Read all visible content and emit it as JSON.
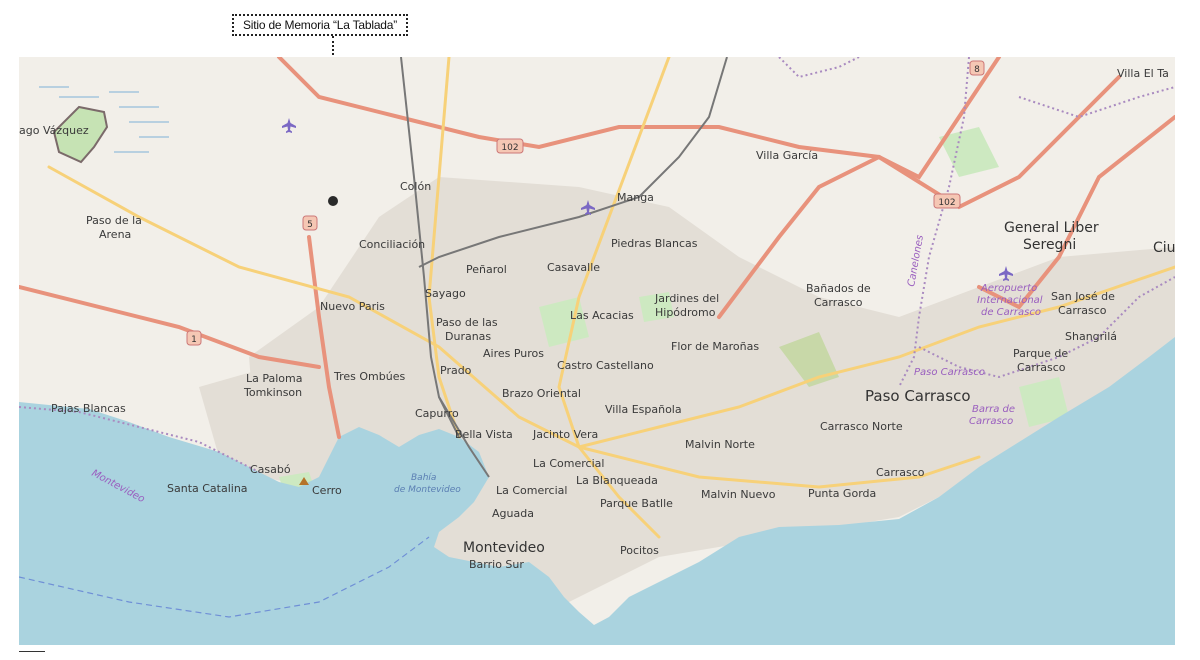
{
  "callout": {
    "text": "Sitio de Memoria “La Tablada”"
  },
  "map": {
    "colors": {
      "land": "#f2efe9",
      "water": "#aad3df",
      "urban": "#e0dcd5",
      "road_major": "#e8927c",
      "road_trunk": "#f7d179",
      "road_minor": "#ffffff",
      "rail": "#777777",
      "park": "#cde9c1",
      "boundary": "#a98ac0"
    },
    "shields": [
      {
        "id": "route-102-west",
        "text": "102"
      },
      {
        "id": "route-102-east",
        "text": "102"
      },
      {
        "id": "route-5",
        "text": "5"
      },
      {
        "id": "route-1",
        "text": "1"
      },
      {
        "id": "route-8",
        "text": "8"
      }
    ],
    "labels": {
      "villa_el_ta": "Villa El Ta",
      "ago_vazquez": "ago Vázquez",
      "villa_garcia": "Villa García",
      "colon": "Colón",
      "manga": "Manga",
      "paso_de_la_arena_1": "Paso de la",
      "paso_de_la_arena_2": "Arena",
      "conciliacion": "Conciliación",
      "piedras_blancas": "Piedras Blancas",
      "general_liber_1": "General Liber",
      "general_liber_2": "Seregni",
      "ciu": "Ciu",
      "penarol": "Peñarol",
      "casavalle": "Casavalle",
      "sayago": "Sayago",
      "jardines_1": "Jardines del",
      "jardines_2": "Hipódromo",
      "banados_1": "Bañados de",
      "banados_2": "Carrasco",
      "nuevo_paris": "Nuevo Paris",
      "las_acacias": "Las Acacias",
      "san_jose_1": "San José de",
      "san_jose_2": "Carrasco",
      "shangrila": "Shangrilá",
      "paso_de_las_1": "Paso de las",
      "paso_de_las_2": "Duranas",
      "aires_puros": "Aires Puros",
      "flor_de_maronas": "Flor de Maroñas",
      "parque_de_1": "Parque de",
      "parque_de_2": "Carrasco",
      "castro_castellano": "Castro Castellano",
      "la_paloma_1": "La Paloma",
      "la_paloma_2": "Tomkinson",
      "tres_ombues": "Tres Ombúes",
      "prado": "Prado",
      "brazo_oriental": "Brazo Oriental",
      "paso_carrasco": "Paso Carrasco",
      "pajas_blancas": "Pajas Blancas",
      "capurro": "Capurro",
      "villa_espanola": "Villa Española",
      "carrasco_norte": "Carrasco Norte",
      "bella_vista": "Bella Vista",
      "jacinto_vera": "Jacinto Vera",
      "malvin_norte": "Malvin Norte",
      "casabo": "Casabó",
      "la_comercial_1": "La Comercial",
      "carrasco": "Carrasco",
      "santa_catalina": "Santa Catalina",
      "cerro": "Cerro",
      "la_comercial_2": "La Comercial",
      "la_blanqueada": "La Blanqueada",
      "malvin_nuevo": "Malvin Nuevo",
      "punta_gorda": "Punta Gorda",
      "parque_batlle": "Parque Batlle",
      "aguada": "Aguada",
      "montevideo": "Montevideo",
      "pocitos": "Pocitos",
      "barrio_sur": "Barrio Sur"
    },
    "water_labels": {
      "bahia_1": "Bahía",
      "bahia_2": "de Montevideo"
    },
    "purple_labels": {
      "montevideo_dept": "Montevideo",
      "canelones": "Canelones",
      "aeropuerto_1": "Aeropuerto",
      "aeropuerto_2": "Internacional",
      "aeropuerto_3": "de Carrasco",
      "paso_carrasco_small": "Paso Carrasco",
      "barra_1": "Barra de",
      "barra_2": "Carrasco"
    },
    "icons": [
      "airplane-icon",
      "airplane-icon",
      "airplane-icon",
      "peak-icon"
    ]
  }
}
